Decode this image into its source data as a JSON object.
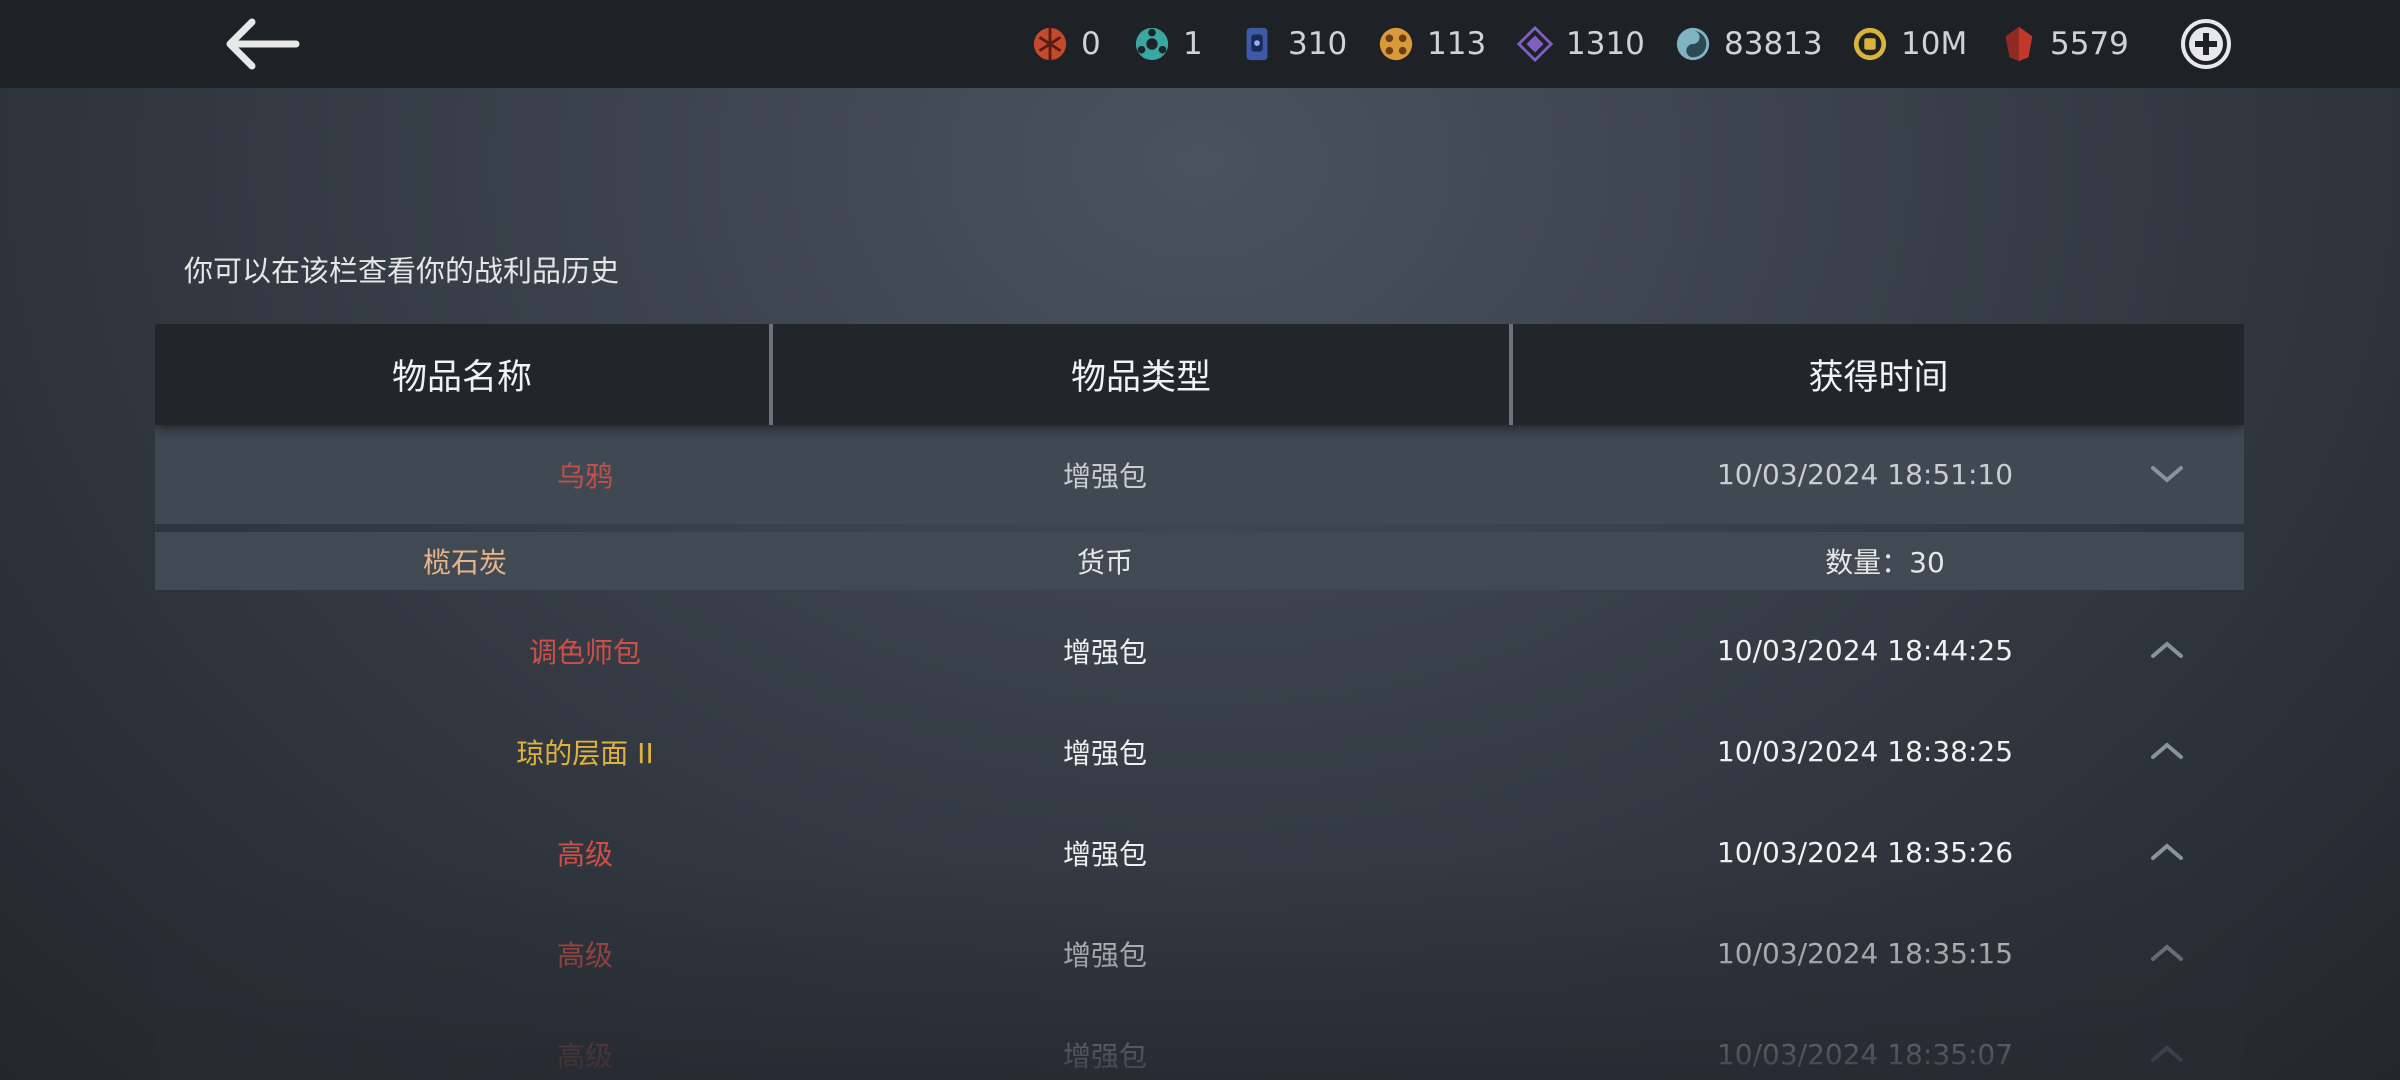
{
  "currencies": [
    {
      "icon": "red-orb-icon",
      "value": "0",
      "color": "#c44a2e"
    },
    {
      "icon": "teal-gear-icon",
      "value": "1",
      "color": "#3aa7a0"
    },
    {
      "icon": "blue-card-icon",
      "value": "310",
      "color": "#3d5aa8"
    },
    {
      "icon": "gold-orb-icon",
      "value": "113",
      "color": "#d99a3c"
    },
    {
      "icon": "purple-diamond-icon",
      "value": "1310",
      "color": "#7f5fc0"
    },
    {
      "icon": "swirl-orb-icon",
      "value": "83813",
      "color": "#7fb4c0"
    },
    {
      "icon": "gold-coin-icon",
      "value": "10M",
      "color": "#d8b43a"
    },
    {
      "icon": "red-gem-icon",
      "value": "5579",
      "color": "#c0392b"
    }
  ],
  "subtitle": "你可以在该栏查看你的战利品历史",
  "table": {
    "headers": [
      "物品名称",
      "物品类型",
      "获得时间"
    ],
    "rows": [
      {
        "name": "乌鸦",
        "name_color": "#c0504a",
        "type": "增强包",
        "time": "10/03/2024 18:51:10",
        "expanded": true
      },
      {
        "name": "调色师包",
        "name_color": "#cf4f48",
        "type": "增强包",
        "time": "10/03/2024 18:44:25",
        "expanded": false
      },
      {
        "name": "琼的层面 II",
        "name_color": "#e0b13c",
        "type": "增强包",
        "time": "10/03/2024 18:38:25",
        "expanded": false
      },
      {
        "name": "高级",
        "name_color": "#cf4f48",
        "type": "增强包",
        "time": "10/03/2024 18:35:26",
        "expanded": false
      },
      {
        "name": "高级",
        "name_color": "#cf4f48",
        "type": "增强包",
        "time": "10/03/2024 18:35:15",
        "expanded": false
      },
      {
        "name": "高级",
        "name_color": "#cf4f48",
        "type": "增强包",
        "time": "10/03/2024 18:35:07",
        "expanded": false
      }
    ],
    "detail": {
      "name": "榄石炭",
      "name_color": "#e6b48a",
      "type": "货币",
      "quantity": "数量：30"
    }
  }
}
